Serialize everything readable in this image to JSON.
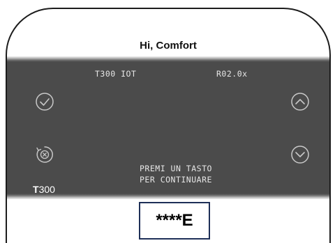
{
  "header": {
    "greeting": "Hi, Comfort"
  },
  "display": {
    "model_label": "T300 IOT",
    "version": "R02.0x",
    "message_line1": "PREMI UN TASTO",
    "message_line2": "PER CONTINUARE",
    "model_code_prefix": "T",
    "model_code_rest": "300"
  },
  "buttons": {
    "confirm_icon": "check-circle-icon",
    "cancel_icon": "cancel-circle-icon",
    "up_icon": "chevron-up-circle-icon",
    "down_icon": "chevron-down-circle-icon"
  },
  "error_code": "****E",
  "colors": {
    "screen": "#4b4b4b",
    "icon": "#c8c8c8",
    "box_border": "#1e2f57"
  }
}
